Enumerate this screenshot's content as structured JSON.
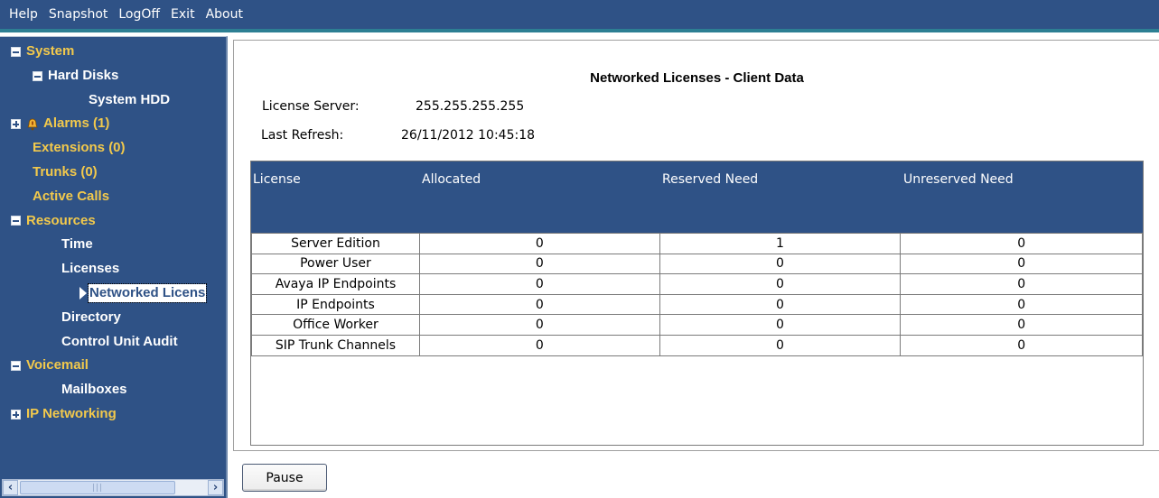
{
  "menu": [
    "Help",
    "Snapshot",
    "LogOff",
    "Exit",
    "About"
  ],
  "tree": {
    "system": "System",
    "hard_disks": "Hard Disks",
    "system_hdd": "System HDD",
    "alarms": "Alarms (1)",
    "extensions": "Extensions (0)",
    "trunks": "Trunks (0)",
    "active_calls": "Active Calls",
    "resources": "Resources",
    "time": "Time",
    "licenses": "Licenses",
    "networked_licenses": "Networked Licens",
    "directory": "Directory",
    "control_unit_audit": "Control Unit Audit",
    "voicemail": "Voicemail",
    "mailboxes": "Mailboxes",
    "ip_networking": "IP Networking"
  },
  "panel": {
    "title": "Networked Licenses - Client Data",
    "license_server_label": "License Server:",
    "license_server_value": "255.255.255.255",
    "last_refresh_label": "Last Refresh:",
    "last_refresh_value": "26/11/2012 10:45:18"
  },
  "table": {
    "headers": [
      "License",
      "Allocated",
      "Reserved Need",
      "Unreserved Need"
    ],
    "rows": [
      [
        "Server Edition",
        "0",
        "1",
        "0"
      ],
      [
        "Power User",
        "0",
        "0",
        "0"
      ],
      [
        "Avaya IP Endpoints",
        "0",
        "0",
        "0"
      ],
      [
        "IP Endpoints",
        "0",
        "0",
        "0"
      ],
      [
        "Office Worker",
        "0",
        "0",
        "0"
      ],
      [
        "SIP Trunk Channels",
        "0",
        "0",
        "0"
      ]
    ]
  },
  "buttons": {
    "pause": "Pause"
  },
  "colors": {
    "chrome": "#2f5286",
    "tree_yellow": "#f2c94c",
    "accent_line": "#2d7f93"
  }
}
